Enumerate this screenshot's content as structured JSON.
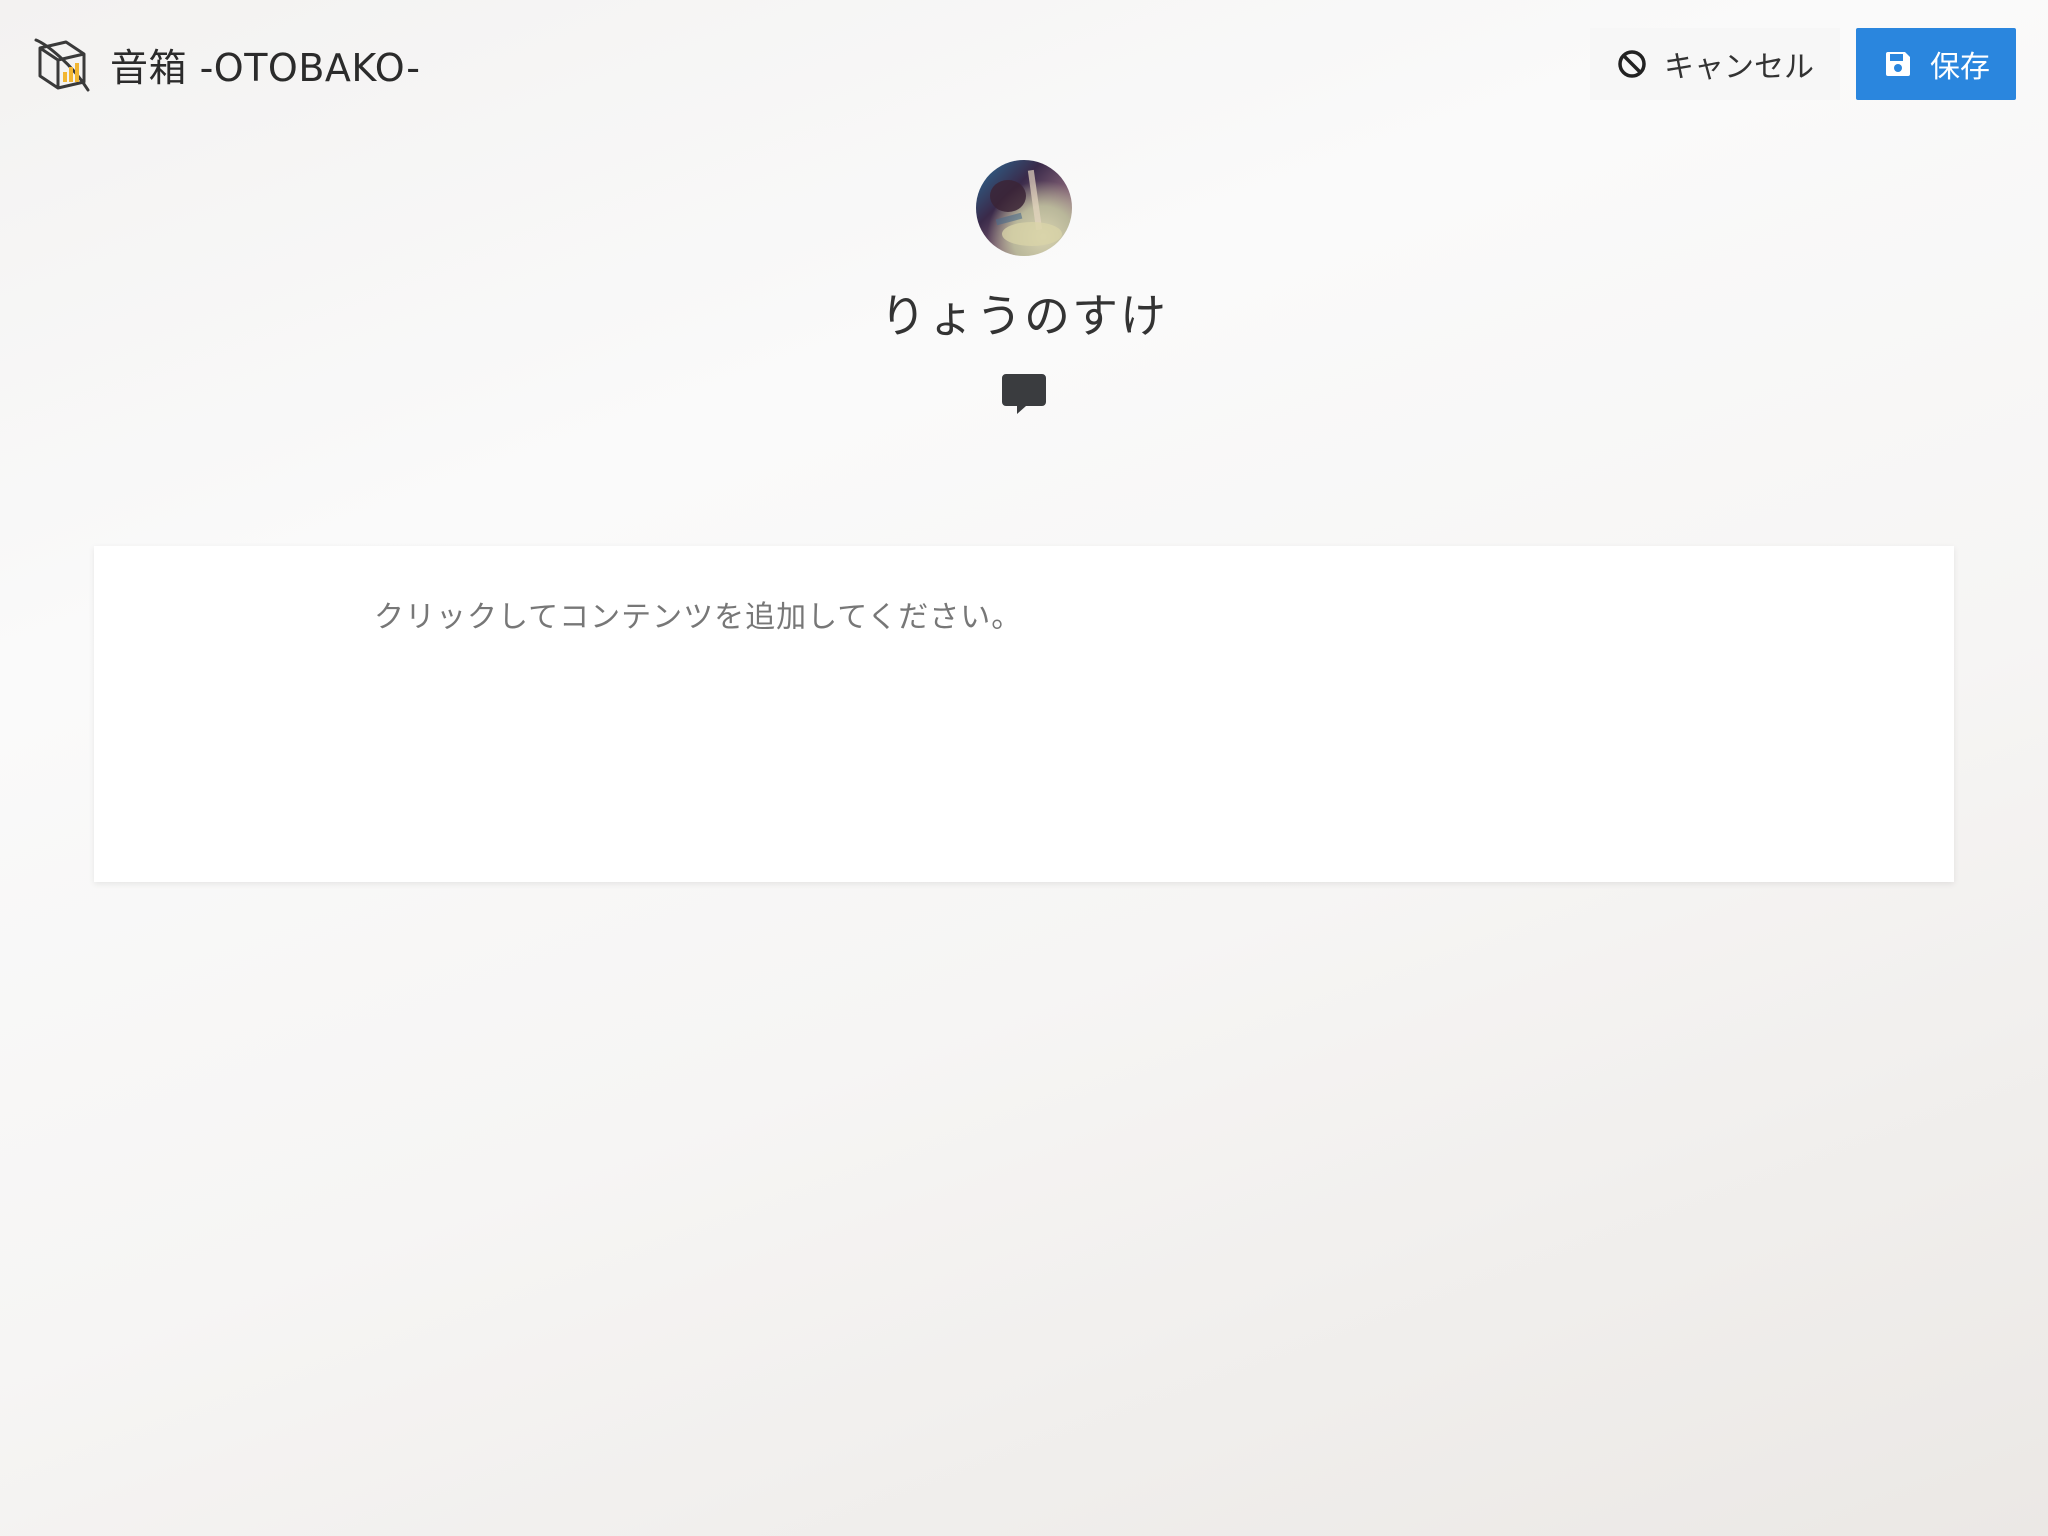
{
  "header": {
    "logo_icon": "otobako-cube-logo-icon",
    "title": "音箱 -OTOBAKO-"
  },
  "actions": {
    "cancel": {
      "label": "キャンセル",
      "icon": "ban-icon"
    },
    "save": {
      "label": "保存",
      "icon": "floppy-disk-icon"
    }
  },
  "profile": {
    "avatar": "user-avatar-photo",
    "name": "りょうのすけ",
    "comment_icon": "comment-icon"
  },
  "content": {
    "placeholder": "クリックしてコンテンツを追加してください。"
  },
  "colors": {
    "primary": "#2a86de",
    "text": "#333333",
    "placeholder": "#777777"
  }
}
